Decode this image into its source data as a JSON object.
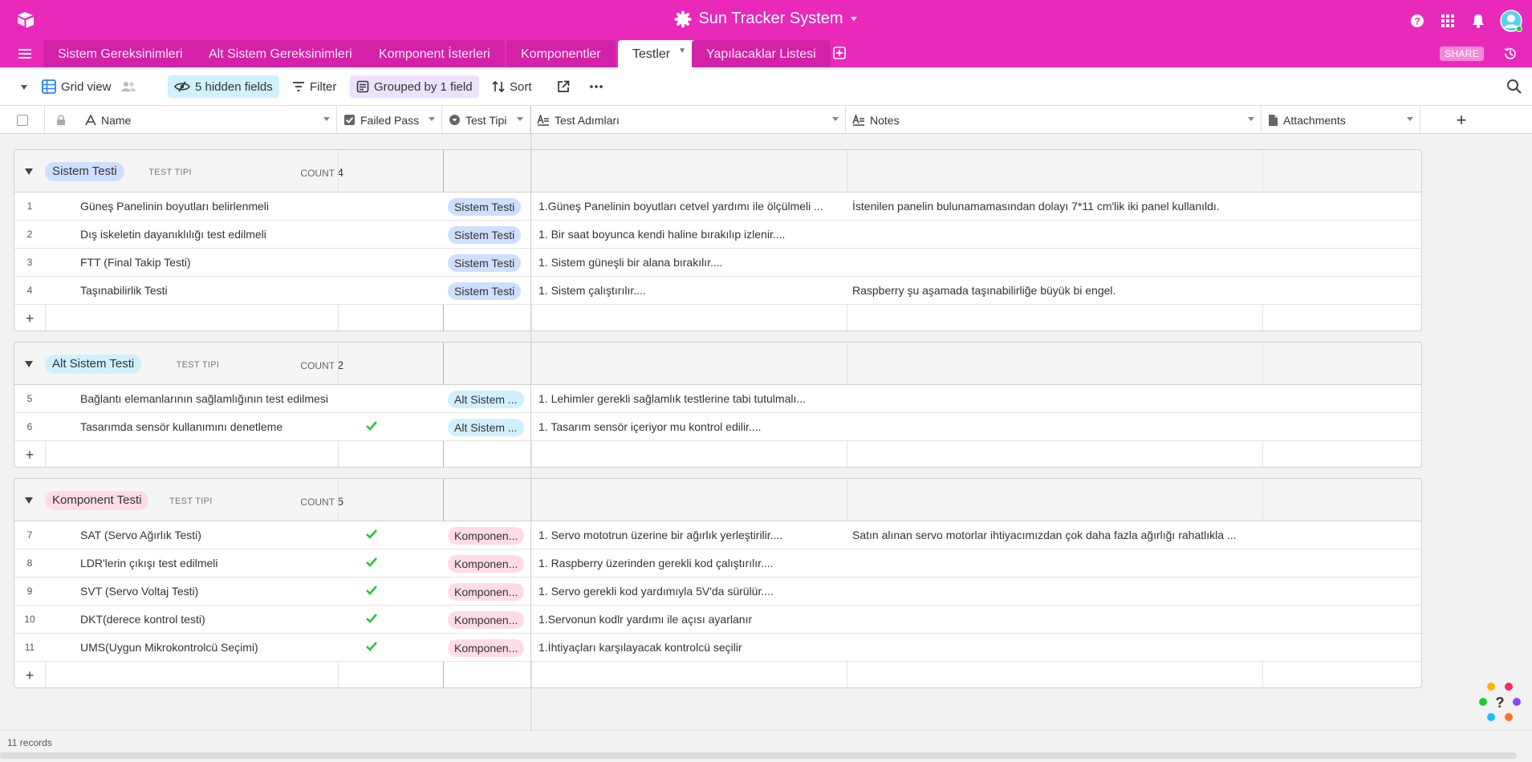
{
  "app": {
    "base_name": "Sun Tracker System",
    "icons": [
      "airtable-logo-icon",
      "sun-icon",
      "help-icon",
      "apps-grid-icon",
      "bell-icon",
      "user-avatar-icon"
    ]
  },
  "colors": {
    "brand": "#e929ba",
    "tab_inactive": "#d321a8",
    "pill_blue": "#cfdfff",
    "pill_cyan": "#d0f0fd",
    "pill_pink": "#ffdce5",
    "check_green": "#20c933"
  },
  "tabs": [
    {
      "label": "Sistem Gereksinimleri",
      "active": false
    },
    {
      "label": "Alt Sistem Gereksinimleri",
      "active": false
    },
    {
      "label": "Komponent İsterleri",
      "active": false
    },
    {
      "label": "Komponentler",
      "active": false
    },
    {
      "label": "Testler",
      "active": true
    },
    {
      "label": "Yapılacaklar Listesi",
      "active": false
    }
  ],
  "tabbar": {
    "share": "SHARE"
  },
  "toolbar": {
    "view_name": "Grid view",
    "hidden_fields": "5 hidden fields",
    "filter": "Filter",
    "grouped": "Grouped by 1 field",
    "sort": "Sort"
  },
  "columns": {
    "name": "Name",
    "failed_pass": "Failed Pass",
    "test_tipi": "Test Tipi",
    "test_adimlari": "Test Adımları",
    "notes": "Notes",
    "attachments": "Attachments"
  },
  "groups": [
    {
      "label": "Sistem Testi",
      "field": "TEST TIPI",
      "count_label": "COUNT",
      "count": "4",
      "pill_color": "#cfdfff",
      "records": [
        {
          "n": "1",
          "name": "Güneş Panelinin boyutları belirlenmeli",
          "passed": false,
          "type": "Sistem Testi",
          "steps": "1.Güneş Panelinin boyutları cetvel yardımı ile ölçülmeli ...",
          "notes": "İstenilen panelin bulunamamasından dolayı 7*11 cm'lik iki panel kullanıldı."
        },
        {
          "n": "2",
          "name": "Dış iskeletin dayanıklılığı test edilmeli",
          "passed": false,
          "type": "Sistem Testi",
          "steps": "1. Bir saat boyunca kendi haline bırakılıp izlenir....",
          "notes": ""
        },
        {
          "n": "3",
          "name": "FTT (Final Takip Testi)",
          "passed": false,
          "type": "Sistem Testi",
          "steps": "1. Sistem güneşli bir alana bırakılır....",
          "notes": ""
        },
        {
          "n": "4",
          "name": "Taşınabilirlik Testi",
          "passed": false,
          "type": "Sistem Testi",
          "steps": "1. Sistem çalıştırılır....",
          "notes": "Raspberry şu aşamada taşınabilirliğe büyük bi engel."
        }
      ]
    },
    {
      "label": "Alt Sistem Testi",
      "field": "TEST TIPI",
      "count_label": "COUNT",
      "count": "2",
      "pill_color": "#d0f0fd",
      "records": [
        {
          "n": "5",
          "name": "Bağlantı elemanlarının sağlamlığının test edilmesi",
          "passed": false,
          "type": "Alt Sistem ...",
          "steps": "1. Lehimler gerekli sağlamlık testlerine tabi tutulmalı...",
          "notes": ""
        },
        {
          "n": "6",
          "name": "Tasarımda sensör kullanımını denetleme",
          "passed": true,
          "type": "Alt Sistem ...",
          "steps": "1. Tasarım sensör içeriyor mu kontrol edilir....",
          "notes": ""
        }
      ]
    },
    {
      "label": "Komponent Testi",
      "field": "TEST TIPI",
      "count_label": "COUNT",
      "count": "5",
      "pill_color": "#ffdce5",
      "records": [
        {
          "n": "7",
          "name": "SAT (Servo Ağırlık Testi)",
          "passed": true,
          "type": "Komponen...",
          "steps": "1. Servo mototrun üzerine bir ağırlık yerleştirilir....",
          "notes": "Satın alınan servo motorlar ihtiyacımızdan çok daha fazla ağırlığı rahatlıkla ..."
        },
        {
          "n": "8",
          "name": "LDR'lerin çıkışı test edilmeli",
          "passed": true,
          "type": "Komponen...",
          "steps": "1. Raspberry üzerinden gerekli kod çalıştırılır....",
          "notes": ""
        },
        {
          "n": "9",
          "name": "SVT (Servo Voltaj Testi)",
          "passed": true,
          "type": "Komponen...",
          "steps": "1. Servo gerekli kod yardımıyla 5V'da sürülür....",
          "notes": ""
        },
        {
          "n": "10",
          "name": "DKT(derece kontrol testi)",
          "passed": true,
          "type": "Komponen...",
          "steps": "1.Servonun kodlr yardımı ile açısı ayarlanır",
          "notes": ""
        },
        {
          "n": "11",
          "name": "UMS(Uygun Mikrokontrolcü Seçimi)",
          "passed": true,
          "type": "Komponen...",
          "steps": "1.İhtiyaçları karşılayacak kontrolcü seçilir",
          "notes": ""
        }
      ]
    }
  ],
  "footer": {
    "records": "11 records"
  }
}
